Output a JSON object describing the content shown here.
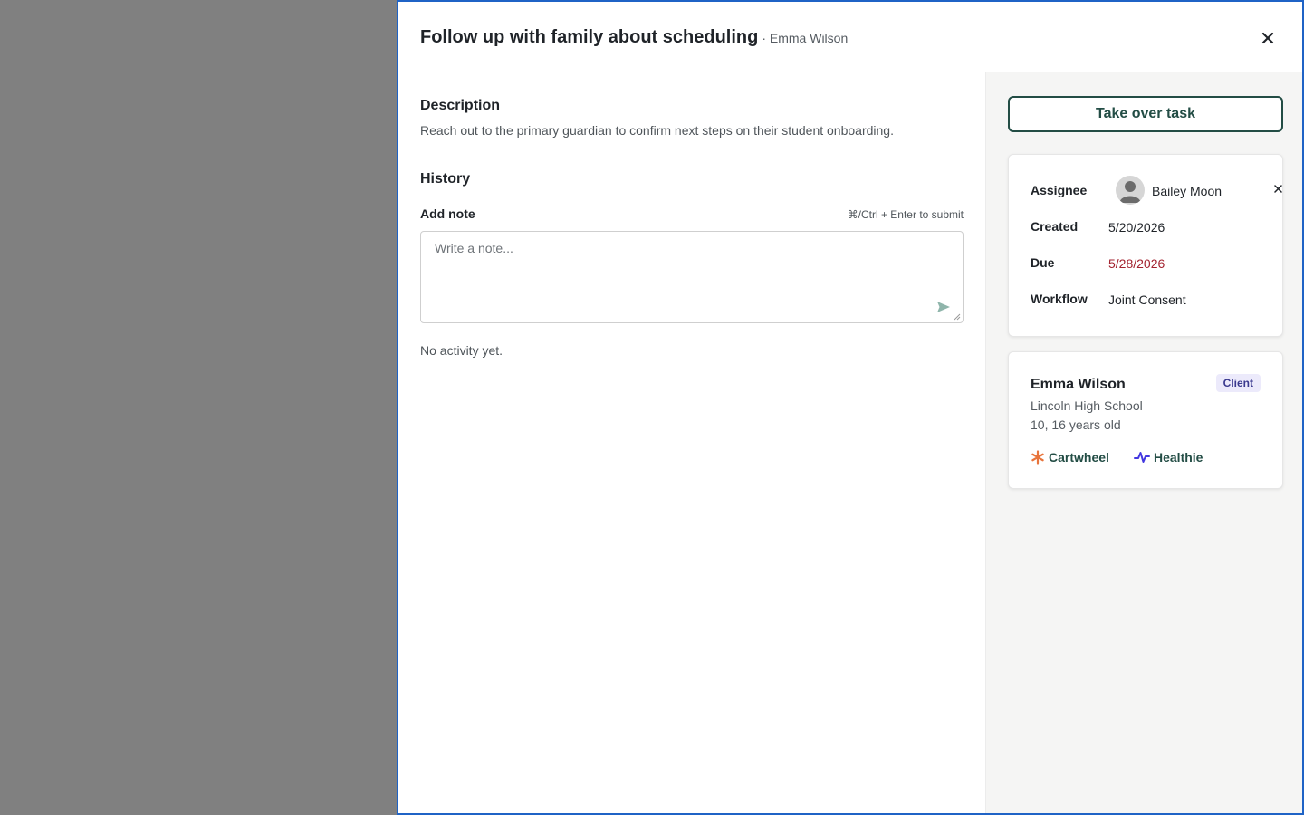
{
  "header": {
    "title": "Follow up with family about scheduling",
    "subtitle": "· Emma Wilson"
  },
  "description": {
    "heading": "Description",
    "text": "Reach out to the primary guardian to confirm next steps on their student onboarding."
  },
  "history": {
    "heading": "History",
    "add_note_label": "Add note",
    "shortcut_hint": "⌘/Ctrl + Enter to submit",
    "note_placeholder": "Write a note...",
    "note_value": "",
    "empty_text": "No activity yet."
  },
  "sidebar": {
    "takeover_label": "Take over task",
    "details": {
      "assignee_label": "Assignee",
      "assignee_name": "Bailey Moon",
      "created_label": "Created",
      "created_value": "5/20/2026",
      "due_label": "Due",
      "due_value": "5/28/2026",
      "workflow_label": "Workflow",
      "workflow_value": "Joint Consent"
    },
    "client": {
      "name": "Emma Wilson",
      "badge": "Client",
      "school": "Lincoln High School",
      "grade_age": "10, 16 years old",
      "integrations": [
        {
          "label": "Cartwheel",
          "icon": "asterisk-icon"
        },
        {
          "label": "Healthie",
          "icon": "pulse-icon"
        }
      ]
    }
  },
  "icons": {
    "close": "close-icon",
    "send": "send-icon",
    "remove_assignee": "close-icon",
    "avatar": "user-avatar-icon"
  },
  "colors": {
    "overlay": "#808080",
    "drawer_border": "#1f63c6",
    "accent_green": "#234d45",
    "due_overdue": "#a3222f",
    "side_panel_bg": "#f5f5f4",
    "badge_bg": "#eceafb",
    "badge_text": "#3b3a8f",
    "cartwheel_icon": "#e8743b",
    "healthie_icon": "#4338e0"
  }
}
